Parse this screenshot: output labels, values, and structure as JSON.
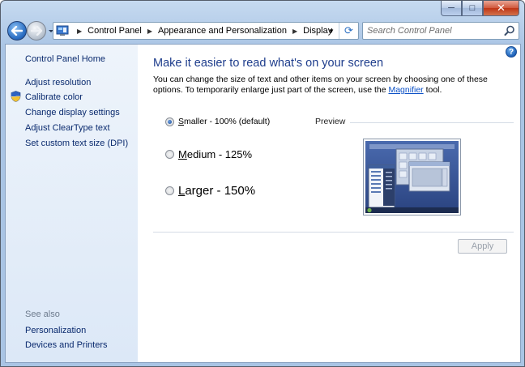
{
  "window": {
    "caption_buttons": {
      "minimize": "─",
      "maximize": "□",
      "close": "✕"
    }
  },
  "toolbar": {
    "breadcrumbs": [
      "Control Panel",
      "Appearance and Personalization",
      "Display"
    ],
    "search_placeholder": "Search Control Panel"
  },
  "sidebar": {
    "home": "Control Panel Home",
    "tasks": [
      "Adjust resolution",
      "Calibrate color",
      "Change display settings",
      "Adjust ClearType text",
      "Set custom text size (DPI)"
    ],
    "see_also_label": "See also",
    "see_also": [
      "Personalization",
      "Devices and Printers"
    ]
  },
  "main": {
    "title": "Make it easier to read what's on your screen",
    "description_part1": "You can change the size of text and other items on your screen by choosing one of these options. To temporarily enlarge just part of the screen, use the ",
    "description_link": "Magnifier",
    "description_part2": " tool.",
    "options": [
      {
        "label": "Smaller - 100% (default)",
        "checked": true
      },
      {
        "label": "Medium - 125%",
        "checked": false
      },
      {
        "label": "Larger - 150%",
        "checked": false
      }
    ],
    "preview_label": "Preview",
    "apply_label": "Apply",
    "help_label": "?"
  },
  "colors": {
    "title_blue": "#1e3d8c",
    "link_blue": "#0b50c6",
    "sidebar_link": "#0a2a6e",
    "frame_bg": "#a9c4e4"
  }
}
